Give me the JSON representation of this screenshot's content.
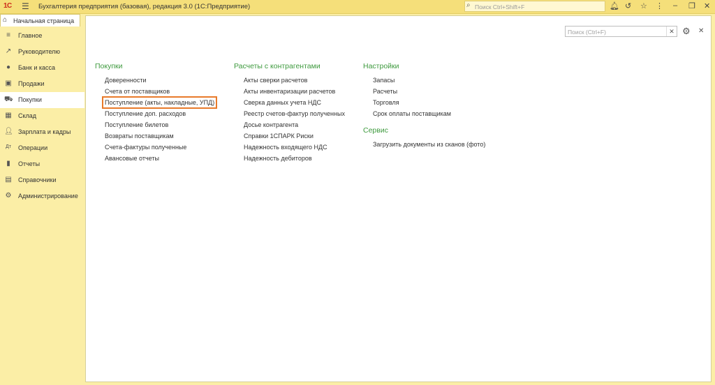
{
  "titlebar": {
    "logo": "1С",
    "title": "Бухгалтерия предприятия (базовая), редакция 3.0  (1С:Предприятие)",
    "search_placeholder": "Поиск Ctrl+Shift+F"
  },
  "tab": {
    "label": "Начальная страница"
  },
  "sidebar": {
    "items": [
      {
        "label": "Главное"
      },
      {
        "label": "Руководителю"
      },
      {
        "label": "Банк и касса"
      },
      {
        "label": "Продажи"
      },
      {
        "label": "Покупки"
      },
      {
        "label": "Склад"
      },
      {
        "label": "Зарплата и кадры"
      },
      {
        "label": "Операции"
      },
      {
        "label": "Отчеты"
      },
      {
        "label": "Справочники"
      },
      {
        "label": "Администрирование"
      }
    ],
    "active_index": 4
  },
  "content": {
    "search_placeholder": "Поиск (Ctrl+F)",
    "columns": [
      {
        "sections": [
          {
            "title": "Покупки",
            "links": [
              "Доверенности",
              "Счета от поставщиков",
              "Поступление (акты, накладные, УПД)",
              "Поступление доп. расходов",
              "Поступление билетов",
              "Возвраты поставщикам",
              "Счета-фактуры полученные",
              "Авансовые отчеты"
            ]
          }
        ]
      },
      {
        "sections": [
          {
            "title": "Расчеты с контрагентами",
            "links": [
              "Акты сверки расчетов",
              "Акты инвентаризации расчетов",
              "Сверка данных учета НДС",
              "Реестр счетов-фактур полученных",
              "Досье контрагента",
              "Справки 1СПАРК Риски",
              "Надежность входящего НДС",
              "Надежность дебиторов"
            ]
          }
        ]
      },
      {
        "sections": [
          {
            "title": "Настройки",
            "links": [
              "Запасы",
              "Расчеты",
              "Торговля",
              "Срок оплаты поставщикам"
            ]
          },
          {
            "title": "Сервис",
            "links": [
              "Загрузить документы из сканов (фото)"
            ]
          }
        ]
      }
    ]
  },
  "colors": {
    "accent_green": "#3e9a3e",
    "highlight": "#e87a2a",
    "sidebar_bg": "#fbeea6"
  }
}
